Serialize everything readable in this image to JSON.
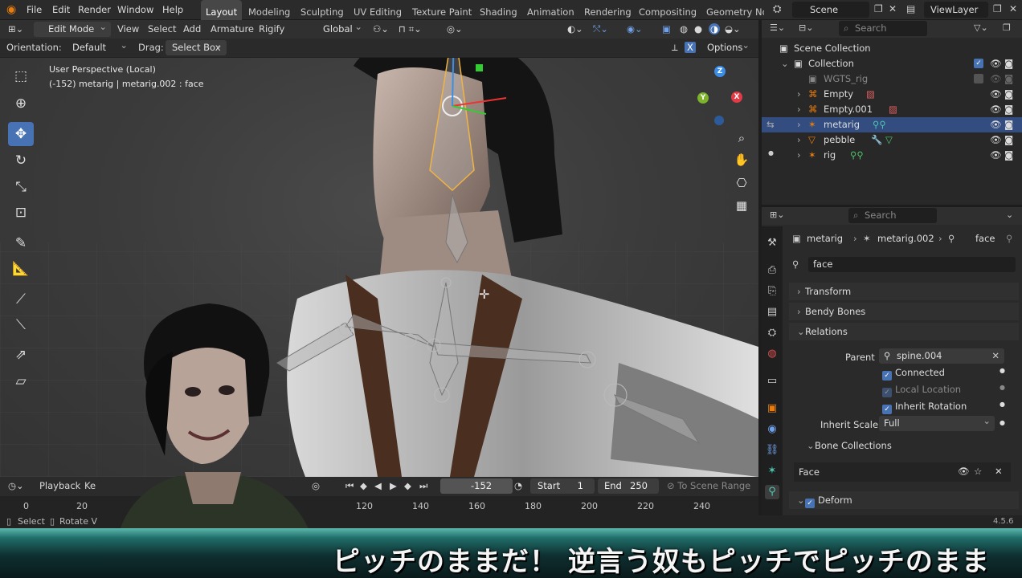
{
  "menus": [
    "File",
    "Edit",
    "Render",
    "Window",
    "Help"
  ],
  "workspaces": [
    "Layout",
    "Modeling",
    "Sculpting",
    "UV Editing",
    "Texture Paint",
    "Shading",
    "Animation",
    "Rendering",
    "Compositing",
    "Geometry Nod"
  ],
  "scene": "Scene",
  "view_layer": "ViewLayer",
  "viewport_header": {
    "mode": "Edit Mode",
    "menus": [
      "View",
      "Select",
      "Add",
      "Armature",
      "Rigify"
    ],
    "transform_orientation": "Global"
  },
  "tool_settings": {
    "orientation_label": "Orientation:",
    "orientation_value": "Default",
    "drag_label": "Drag:",
    "drag_value": "Select Box",
    "options_label": "Options"
  },
  "viewport_info": {
    "line1": "User Perspective (Local)",
    "line2": "(-152) metarig | metarig.002 : face"
  },
  "gizmo_axes": [
    "Z",
    "X",
    "Y"
  ],
  "timeline": {
    "playback": "Playback",
    "keying": "Ke",
    "current_frame": "-152",
    "start_label": "Start",
    "start_value": "1",
    "end_label": "End",
    "end_value": "250",
    "scene_range": "To Scene Range",
    "ticks": [
      "0",
      "20",
      "120",
      "140",
      "160",
      "180",
      "200",
      "220",
      "240"
    ]
  },
  "statusbar": {
    "select": "Select",
    "rotate": "Rotate V",
    "version": "4.5.6"
  },
  "outliner": {
    "search_placeholder": "Search",
    "root": "Scene Collection",
    "collection": "Collection",
    "items": [
      "WGTS_rig",
      "Empty",
      "Empty.001",
      "metarig",
      "pebble",
      "rig"
    ]
  },
  "properties": {
    "search_placeholder": "Search",
    "breadcrumb": [
      "metarig",
      "metarig.002",
      "face"
    ],
    "bone_name": "face",
    "panels": {
      "transform": "Transform",
      "bendy": "Bendy Bones",
      "relations": "Relations",
      "bone_collections": "Bone Collections",
      "deform": "Deform"
    },
    "parent_label": "Parent",
    "parent_value": "spine.004",
    "connected": "Connected",
    "local_location": "Local Location",
    "inherit_rotation": "Inherit Rotation",
    "inherit_scale_label": "Inherit Scale",
    "inherit_scale_value": "Full",
    "collection_item": "Face"
  },
  "subtitle": "ピッチのままだ！ 逆言う奴もピッチでピッチのまま",
  "colors": {
    "accent": "#4772b3",
    "orange": "#e87d0d",
    "selected_row": "#334d80"
  }
}
